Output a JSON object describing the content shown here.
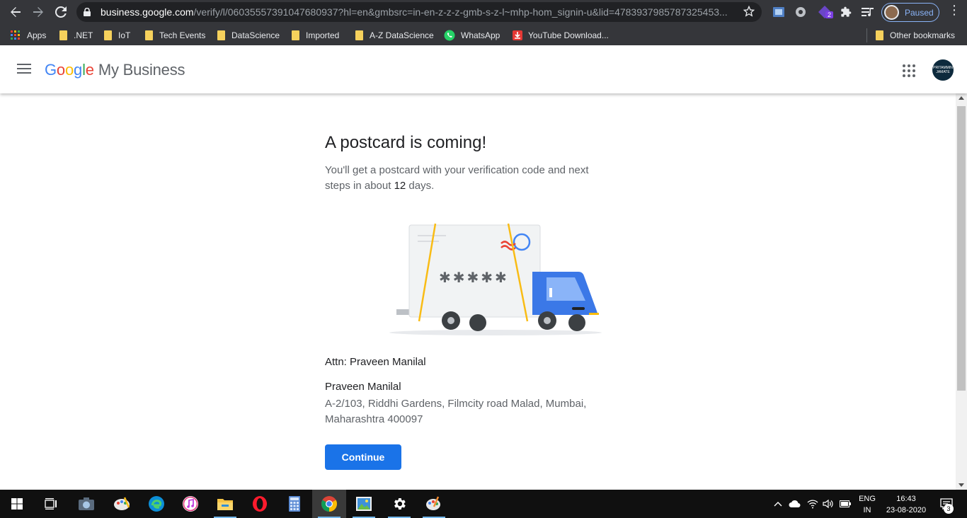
{
  "browser": {
    "url_host": "business.google.com",
    "url_path": "/verify/l/06035557391047680937?hl=en&gmbsrc=in-en-z-z-z-gmb-s-z-l~mhp-hom_signin-u&lid=4783937985787325453...",
    "profile_label": "Paused",
    "extension_badge": "2",
    "icons": [
      "back-icon",
      "forward-icon",
      "reload-icon",
      "lock-icon",
      "star-icon",
      "extensions-icon",
      "reading-list-icon"
    ]
  },
  "bookmarks": {
    "items": [
      {
        "label": "Apps",
        "icon": "apps-icon"
      },
      {
        "label": ".NET",
        "icon": "folder-icon"
      },
      {
        "label": "IoT",
        "icon": "folder-icon"
      },
      {
        "label": "Tech Events",
        "icon": "folder-icon"
      },
      {
        "label": "DataScience",
        "icon": "folder-icon"
      },
      {
        "label": "Imported",
        "icon": "folder-icon"
      },
      {
        "label": "A-Z DataScience",
        "icon": "folder-icon"
      },
      {
        "label": "WhatsApp",
        "icon": "whatsapp-icon"
      },
      {
        "label": "YouTube Download...",
        "icon": "download-icon"
      }
    ],
    "other": "Other bookmarks"
  },
  "header": {
    "logo_google": [
      "G",
      "o",
      "o",
      "g",
      "l",
      "e"
    ],
    "logo_product": "My Business",
    "avatar_text": "PRITAMMIN JAMATE"
  },
  "main": {
    "title": "A postcard is coming!",
    "subtitle_before": "You'll get a postcard with your verification code and next steps in about ",
    "subtitle_days": "12",
    "subtitle_after": " days.",
    "postcard_code": "✱✱✱✱✱",
    "attn": "Attn: Praveen Manilal",
    "address_name": "Praveen Manilal",
    "address_line": "A-2/103, Riddhi Gardens, Filmcity road Malad, Mumbai, Maharashtra 400097",
    "continue_label": "Continue"
  },
  "taskbar": {
    "language": "ENG",
    "region": "IN",
    "time": "16:43",
    "date": "23-08-2020",
    "notification_count": "3",
    "apps": [
      "windows-start-icon",
      "task-view-icon",
      "camera-icon",
      "paint-icon",
      "edge-icon",
      "itunes-icon",
      "file-explorer-icon",
      "opera-icon",
      "calculator-icon",
      "chrome-icon",
      "photos-icon",
      "settings-icon",
      "paint3d-icon"
    ]
  },
  "colors": {
    "primary_button": "#1a73e8",
    "truck_blue": "#3b78e7",
    "tape_yellow": "#f9bc15",
    "stamp_red": "#ea4335"
  }
}
